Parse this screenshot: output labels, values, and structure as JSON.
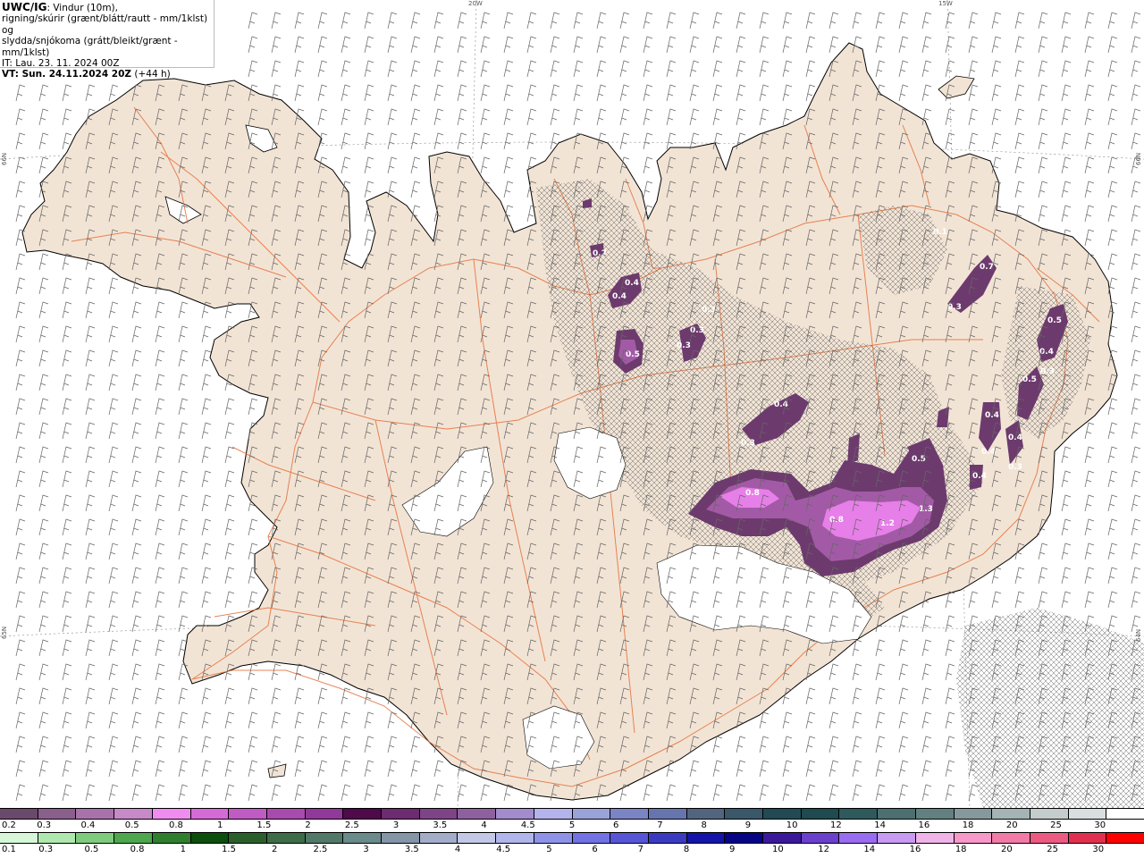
{
  "title": {
    "product": "UWC/IG",
    "line1_rest": ": Vindur (10m),",
    "line2": "rigning/skúrir (grænt/blátt/rautt - mm/1klst) og",
    "line3": "slydda/snjókoma (grátt/bleikt/grænt - mm/1klst)",
    "initial_time": "IT: Lau. 23. 11. 2024 00Z",
    "valid_prefix": "VT: Sun. 24.11.2024 20Z",
    "valid_offset": " (+44 h)"
  },
  "grid_labels": {
    "lon_20w": "20W",
    "lon_15w": "15W",
    "lat_66n_left": "66N",
    "lat_66n_right": "66N",
    "lat_65n_left": "65N",
    "lat_64n_right": "64N"
  },
  "precip_labels": [
    "0.1",
    "0.2",
    "0.4",
    "0.4",
    "0.5",
    "0.3",
    "0.3",
    "0.3",
    "0.7",
    "0.3",
    "0.5",
    "0.4",
    "0.3",
    "0.5",
    "0.4",
    "0.4",
    "0.3",
    "0.4",
    "0.4",
    "0.3",
    "0.4",
    "0.5",
    "0.8",
    "0.8",
    "1.2",
    "1.3"
  ],
  "colors": {
    "land": "#f2e4d5",
    "sea": "#ffffff",
    "roads": "#e4703a",
    "glacier": "#ffffff",
    "snow_light": "#6d3a6e",
    "snow_mid": "#a35aa6",
    "snow_heavy": "#e77fe8"
  },
  "legend": {
    "snow_scale": {
      "colors": [
        "#6a4a6c",
        "#8a5f8c",
        "#a873aa",
        "#c68ac8",
        "#f08cf0",
        "#d46bd6",
        "#c05bc4",
        "#a94aae",
        "#90399a",
        "#4f0a4a",
        "#6d2b70",
        "#7d4585",
        "#8d619e",
        "#a28ccc",
        "#b5b3ec",
        "#9aa3d8",
        "#7b84c4",
        "#6775ae",
        "#51657f",
        "#3a5869",
        "#214a55",
        "#1f4a50",
        "#2f5a5c",
        "#4c6f70",
        "#62807f",
        "#86999a",
        "#a4b3b4",
        "#c4cccc",
        "#d9dfe0",
        "#ffffff"
      ],
      "labels": [
        "0.2",
        "0.3",
        "0.4",
        "0.5",
        "0.8",
        "1",
        "1.5",
        "2",
        "2.5",
        "3",
        "3.5",
        "4",
        "4.5",
        "5",
        "6",
        "7",
        "8",
        "9",
        "10",
        "12",
        "14",
        "16",
        "18",
        "20",
        "25",
        "30"
      ]
    },
    "rain_scale": {
      "colors": [
        "#d8f7d8",
        "#aee8ae",
        "#7ecb7e",
        "#4ea64e",
        "#2f7f2f",
        "#0c4e0c",
        "#2b5e2b",
        "#3e6c48",
        "#52786a",
        "#6b8a8a",
        "#8495a8",
        "#a3adc8",
        "#c2c8e6",
        "#b0b5ec",
        "#8f93e8",
        "#7272e4",
        "#5656d6",
        "#3b3bc2",
        "#1414a8",
        "#050585",
        "#3a1a9a",
        "#6a40cc",
        "#9a6cf0",
        "#c89af2",
        "#f0b4e8",
        "#f898c8",
        "#f27aa6",
        "#ec5a82",
        "#e03050",
        "#ff0000"
      ],
      "labels": [
        "0.1",
        "0.3",
        "0.5",
        "0.8",
        "1",
        "1.5",
        "2",
        "2.5",
        "3",
        "3.5",
        "4",
        "4.5",
        "5",
        "6",
        "7",
        "8",
        "9",
        "10",
        "12",
        "14",
        "16",
        "18",
        "20",
        "25",
        "30"
      ]
    }
  }
}
